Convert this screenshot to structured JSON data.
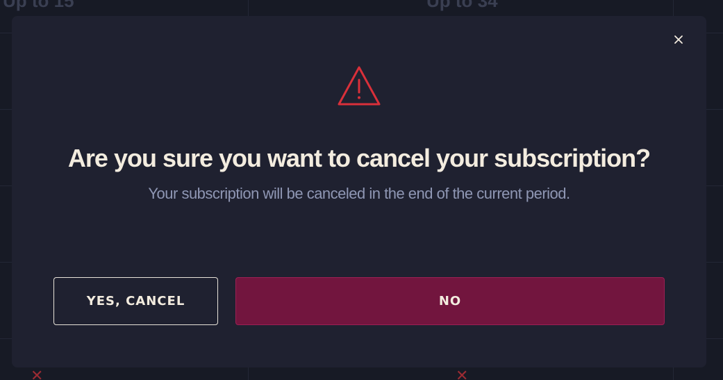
{
  "background": {
    "plan_limits": [
      "Up to 15",
      "Up to 34"
    ],
    "marks": [
      "✕",
      "✕"
    ]
  },
  "modal": {
    "close_icon": "close-icon",
    "warning_icon": "warning-triangle-icon",
    "title": "Are you sure you want to cancel your subscription?",
    "subtitle": "Your subscription will be canceled in the end of the current period.",
    "yes_label": "YES, CANCEL",
    "no_label": "NO"
  },
  "colors": {
    "backdrop": "#171a25",
    "modal_bg": "#1f2130",
    "warning": "#d9303a",
    "title": "#f3ecdf",
    "subtitle": "#8f97b4",
    "primary_button": "#72153e"
  }
}
